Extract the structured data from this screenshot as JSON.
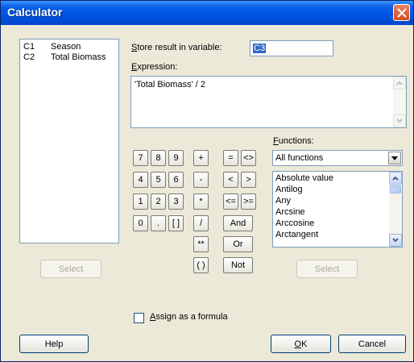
{
  "window": {
    "title": "Calculator"
  },
  "variables": [
    {
      "col": "C1",
      "name": "Season"
    },
    {
      "col": "C2",
      "name": "Total Biomass"
    }
  ],
  "store_label_pre": "S",
  "store_label_rest": "tore result in variable:",
  "store_value": "C3",
  "expression_label_pre": "E",
  "expression_label_rest": "xpression:",
  "expression_value": "'Total Biomass' / 2",
  "keypad": {
    "row1": [
      "7",
      "8",
      "9",
      "+",
      "=",
      "<>"
    ],
    "row2": [
      "4",
      "5",
      "6",
      "-",
      "<",
      ">"
    ],
    "row3": [
      "1",
      "2",
      "3",
      "*",
      "<=",
      ">="
    ],
    "row4": [
      "0",
      ".",
      "[ ]",
      "/",
      "And"
    ],
    "row5": [
      "**",
      "Or"
    ],
    "row6": [
      "( )",
      "Not"
    ]
  },
  "functions_label_pre": "F",
  "functions_label_rest": "unctions:",
  "functions_dropdown": "All functions",
  "functions_list": [
    "Absolute value",
    "Antilog",
    "Any",
    "Arcsine",
    "Arccosine",
    "Arctangent"
  ],
  "select_left": "Select",
  "select_right": "Select",
  "assign_pre": "A",
  "assign_rest": "ssign as a formula",
  "help": "Help",
  "ok_pre": "O",
  "ok_rest": "K",
  "cancel": "Cancel"
}
